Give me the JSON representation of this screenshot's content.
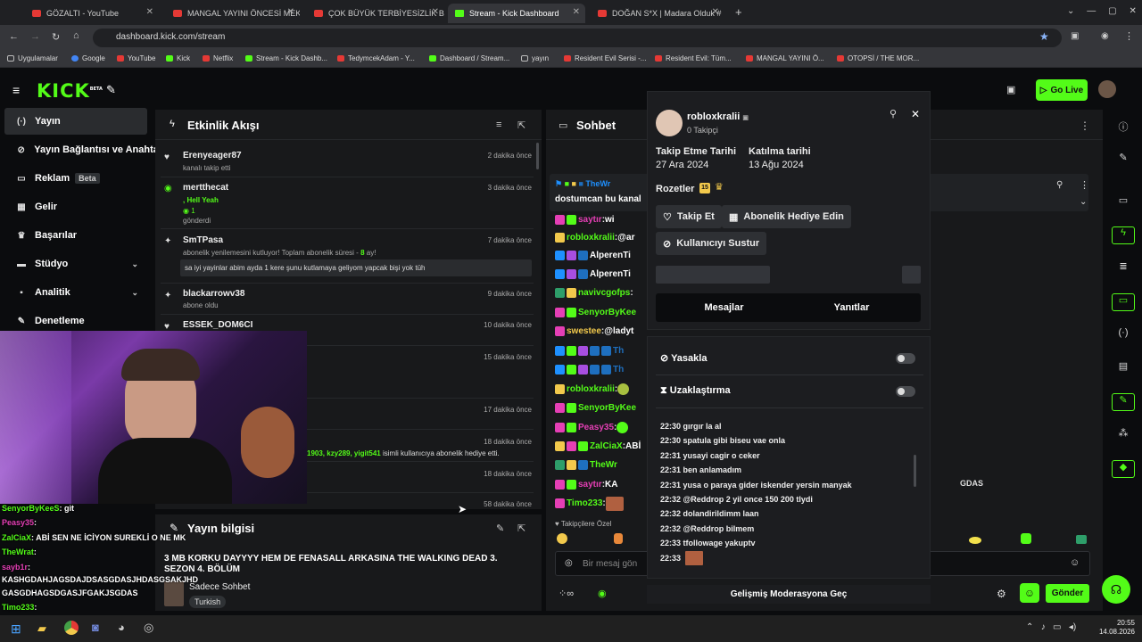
{
  "browser": {
    "tabs": [
      {
        "label": "GÖZALTI - YouTube",
        "type": "yt"
      },
      {
        "label": "MANGAL YAYINI ÖNCESİ MEKİ",
        "type": "yt"
      },
      {
        "label": "ÇOK BÜYÜK TERBİYESİZLİK BEN",
        "type": "yt"
      },
      {
        "label": "Stream - Kick Dashboard",
        "type": "kick"
      },
      {
        "label": "DOĞAN S*X | Madara Olduk #",
        "type": "yt"
      }
    ],
    "new_tab": "+",
    "url": "dashboard.kick.com/stream",
    "bookmarks": [
      "Uygulamalar",
      "Google",
      "YouTube",
      "Kick",
      "Netflix",
      "Stream - Kick Dashb...",
      "TedymcekAdam - Y...",
      "Dashboard / Stream...",
      "yayın",
      "Resident Evil Serisi -...",
      "Resident Evil: Tüm...",
      "MANGAL YAYINI Ö...",
      "OTOPSİ / THE MOR..."
    ]
  },
  "header": {
    "logo": "KICK",
    "beta": "BETA",
    "go_live": "Go Live"
  },
  "sidebar": {
    "items": [
      {
        "label": "Yayın",
        "icon": "(·)"
      },
      {
        "label": "Yayın Bağlantısı ve Anahtar",
        "icon": "⊘"
      },
      {
        "label": "Reklam",
        "icon": "▭",
        "badge": "Beta"
      },
      {
        "label": "Gelir",
        "icon": "▦"
      },
      {
        "label": "Başarılar",
        "icon": "♛"
      },
      {
        "label": "Stüdyo",
        "icon": "▬"
      },
      {
        "label": "Analitik",
        "icon": "▪"
      },
      {
        "label": "Denetleme",
        "icon": "✎"
      }
    ]
  },
  "activity": {
    "title": "Etkinlik Akışı",
    "events": [
      {
        "name": "Erenyeager87",
        "sub": "kanalı takip etti",
        "time": "2 dakika önce"
      },
      {
        "name": "mertthecat",
        "sub": ", Hell Yeah",
        "extra": "1",
        "sub2": "gönderdi",
        "time": "3 dakika önce"
      },
      {
        "name": "SmTPasa",
        "sub": "abonelik yenilemesini kutluyor! Toplam abonelik süresi -",
        "months": "8",
        "sub_suffix": "ay!",
        "quote": "sa iyi yayinlar abim ayda 1 kere şunu kutlamaya geliyom yapcak bişi yok tüh",
        "time": "7 dakika önce"
      },
      {
        "name": "blackarrowv38",
        "sub": "abone oldu",
        "time": "9 dakika önce"
      },
      {
        "name": "ESSEK_DOM6CI",
        "sub": "",
        "time": "10 dakika önce"
      },
      {
        "name": "",
        "sub": "",
        "time": "15 dakika önce"
      },
      {
        "name": "",
        "sub": "",
        "time": "17 dakika önce"
      },
      {
        "name": "",
        "sub": "",
        "gifts": "1903, kzy289, yigit541",
        "gift_text": "isimli kullanıcıya abonelik hediye etti.",
        "time": "18 dakika önce"
      },
      {
        "name": "",
        "sub": "",
        "time": "18 dakika önce"
      },
      {
        "name": "",
        "sub": "",
        "time": "58 dakika önce"
      }
    ]
  },
  "stream_info": {
    "title": "Yayın bilgisi",
    "stream_title": "3 MB KORKU DAYYYY HEM DE FENASALL ARKASINA THE WALKING DEAD 3. SEZON 4. BÖLÜM",
    "category": "Sadece Sohbet",
    "language": "Turkish"
  },
  "chat": {
    "title": "Sohbet",
    "pinned": "dostumcan bu kanal",
    "lines": [
      {
        "user": "saytır",
        "text": "wi",
        "color": "#e53fb5"
      },
      {
        "user": "robloxkralii",
        "text": "@ar",
        "color": "#53fc18"
      },
      {
        "user": "AlperenTi",
        "text": "",
        "color": "#fff"
      },
      {
        "user": "AlperenTi",
        "text": "",
        "color": "#fff"
      },
      {
        "user": "navivcgofps",
        "text": "",
        "color": "#53fc18"
      },
      {
        "user": "SenyorByKee",
        "text": "",
        "color": "#53fc18"
      },
      {
        "user": "swestee",
        "text": "@ladyt",
        "color": "#f2c94c"
      },
      {
        "user": "Th",
        "text": "",
        "color": "#1e6fbf"
      },
      {
        "user": "Th",
        "text": "",
        "color": "#1e6fbf"
      },
      {
        "user": "robloxkralii",
        "text": "",
        "color": "#53fc18"
      },
      {
        "user": "SenyorByKee",
        "text": "",
        "color": "#53fc18"
      },
      {
        "user": "Peasy35",
        "text": "",
        "color": "#e53fb5"
      },
      {
        "user": "ZalCiaX",
        "text": "ABİ",
        "color": "#53fc18"
      },
      {
        "user": "TheWr",
        "text": "",
        "color": "#53fc18"
      },
      {
        "user": "saytır",
        "text": "KA",
        "color": "#e53fb5"
      },
      {
        "user": "Timo233",
        "text": "",
        "color": "#53fc18"
      }
    ],
    "followers_only": "Takipçilere Özel",
    "input_placeholder": "Bir mesaj gön",
    "send": "Gönder",
    "extra_text": "GDAS"
  },
  "usercard": {
    "username": "robloxkralii",
    "followers": "0 Takipçi",
    "follow_date_label": "Takip Etme Tarihi",
    "follow_date": "27 Ara 2024",
    "join_date_label": "Katılma tarihi",
    "join_date": "13 Ağu 2024",
    "badges_label": "Rozetler",
    "badge_num": "15",
    "follow_btn": "Takip Et",
    "gift_btn": "Abonelik Hediye Edin",
    "mute_btn": "Kullanıcıyı Sustur",
    "tab_messages": "Mesajlar",
    "tab_replies": "Yanıtlar"
  },
  "modcard": {
    "ban": "Yasakla",
    "timeout": "Uzaklaştırma",
    "log": [
      "22:30 gırgır la al",
      "22:30 spatula gibi biseu vae onla",
      "22:31 yusayi cagir o ceker",
      "22:31 ben anlamadım",
      "22:31 yusa o paraya gider iskender yersin manyak",
      "22:32 @Reddrop 2 yil once 150 200 tlydi",
      "22:32 dolandirildimm laan",
      "22:32 @Reddrop bilmem",
      "22:33 tfollowage yakuptv",
      "22:33"
    ],
    "advanced": "Gelişmiş Moderasyona Geç"
  },
  "webcam_chat": [
    {
      "user": "SenyorByKeeS",
      "text": ": git",
      "color": "#53fc18"
    },
    {
      "user": "Peasy35",
      "text": ":",
      "color": "#e53fb5"
    },
    {
      "user": "ZalCiaX",
      "text": ": ABİ SEN NE İCİYON SUREKLİ O NE MK",
      "color": "#53fc18"
    },
    {
      "user": "TheWrat",
      "text": ":",
      "color": "#53fc18"
    },
    {
      "user": "sayb1r",
      "text": ":",
      "color": "#e53fb5"
    },
    {
      "user": "",
      "text": "KASHGDAHJAGSDAJDSASGDASJHDASGSAKJHD",
      "color": "#fff"
    },
    {
      "user": "",
      "text": "GASGDHAGSDGASJFGAKJSGDAS",
      "color": "#fff"
    },
    {
      "user": "Timo233",
      "text": ":",
      "color": "#53fc18"
    }
  ],
  "taskbar": {
    "time": "20:55",
    "date": "14.08.2026"
  }
}
